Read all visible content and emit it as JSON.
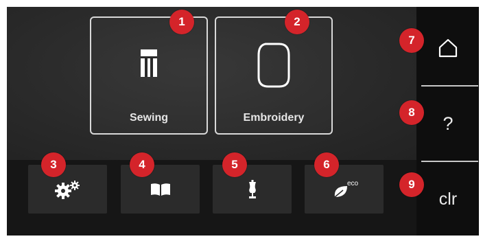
{
  "modes": {
    "sewing": {
      "label": "Sewing",
      "icon": "presser-foot-icon"
    },
    "embroidery": {
      "label": "Embroidery",
      "icon": "embroidery-hoop-icon"
    }
  },
  "tools": [
    {
      "icon": "settings-gears-icon"
    },
    {
      "icon": "book-icon"
    },
    {
      "icon": "dress-form-icon"
    },
    {
      "icon": "eco-leaf-icon",
      "badge": "eco"
    }
  ],
  "side": {
    "home_icon": "home-icon",
    "help_label": "?",
    "clear_label": "clr"
  },
  "callouts": [
    "1",
    "2",
    "3",
    "4",
    "5",
    "6",
    "7",
    "8",
    "9"
  ],
  "colors": {
    "callout": "#d4242a",
    "screen_bg": "#1b1b1b",
    "side_bg": "#0e0e0e",
    "tile_border": "#d9d9d9",
    "text": "#e6e6e6"
  }
}
